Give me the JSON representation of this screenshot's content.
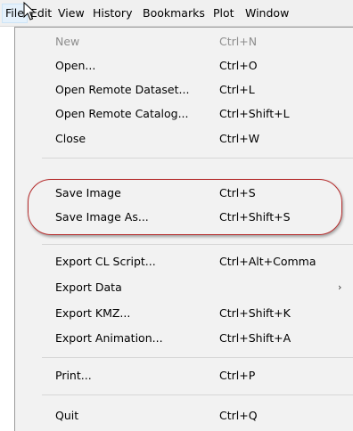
{
  "menubar": {
    "items": [
      "File",
      "Edit",
      "View",
      "History",
      "Bookmarks",
      "Plot",
      "Window"
    ]
  },
  "menu": {
    "items": [
      {
        "label": "New",
        "shortcut": "Ctrl+N",
        "enabled": false
      },
      {
        "label": "Open...",
        "shortcut": "Ctrl+O"
      },
      {
        "label": "Open Remote Dataset...",
        "shortcut": "Ctrl+L"
      },
      {
        "label": "Open Remote Catalog...",
        "shortcut": "Ctrl+Shift+L"
      },
      {
        "label": "Close",
        "shortcut": "Ctrl+W"
      },
      {
        "label": "Save Image",
        "shortcut": "Ctrl+S"
      },
      {
        "label": "Save Image As...",
        "shortcut": "Ctrl+Shift+S"
      },
      {
        "label": "Export CL Script...",
        "shortcut": "Ctrl+Alt+Comma"
      },
      {
        "label": "Export Data",
        "shortcut": "",
        "submenu": true
      },
      {
        "label": "Export KMZ...",
        "shortcut": "Ctrl+Shift+K"
      },
      {
        "label": "Export Animation...",
        "shortcut": "Ctrl+Shift+A"
      },
      {
        "label": "Print...",
        "shortcut": "Ctrl+P"
      },
      {
        "label": "Quit",
        "shortcut": "Ctrl+Q"
      }
    ]
  },
  "colors": {
    "highlight_ring": "#b52a2a",
    "menu_background": "#f2f2f2",
    "disabled_text": "#8d8d8d"
  }
}
